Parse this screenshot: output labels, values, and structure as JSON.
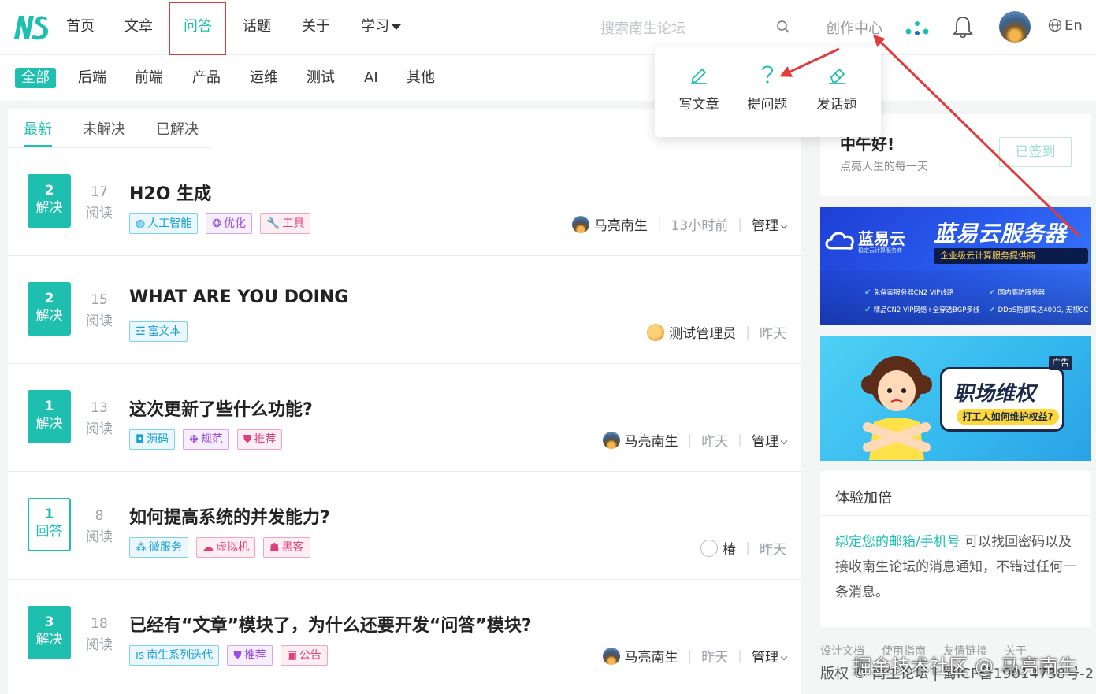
{
  "header": {
    "nav": [
      "首页",
      "文章",
      "问答",
      "话题",
      "关于",
      "学习"
    ],
    "active_nav": "问答",
    "search_placeholder": "搜索南生论坛",
    "creator": "创作中心",
    "lang": "En"
  },
  "creator_menu": [
    "写文章",
    "提问题",
    "发话题"
  ],
  "categories": [
    "全部",
    "后端",
    "前端",
    "产品",
    "运维",
    "测试",
    "AI",
    "其他"
  ],
  "tabs": [
    "最新",
    "未解决",
    "已解决"
  ],
  "questions": [
    {
      "count": "2",
      "status": "解决",
      "views": "17",
      "views_label": "阅读",
      "title": "H2O 生成",
      "tags": [
        {
          "label": "人工智能",
          "style": "cyan",
          "icon": "◍"
        },
        {
          "label": "优化",
          "style": "purple",
          "icon": "❂"
        },
        {
          "label": "工具",
          "style": "pink",
          "icon": "🔧"
        }
      ],
      "author": "马亮南生",
      "time": "13小时前",
      "manage": "管理"
    },
    {
      "count": "2",
      "status": "解决",
      "views": "15",
      "views_label": "阅读",
      "title": "WHAT ARE YOU DOING",
      "tags": [
        {
          "label": "富文本",
          "style": "cyan",
          "icon": "☲"
        }
      ],
      "author": "测试管理员",
      "time": "昨天",
      "manage": ""
    },
    {
      "count": "1",
      "status": "解决",
      "views": "13",
      "views_label": "阅读",
      "title": "这次更新了些什么功能?",
      "tags": [
        {
          "label": "源码",
          "style": "cyan",
          "icon": "◘"
        },
        {
          "label": "规范",
          "style": "purple",
          "icon": "❉"
        },
        {
          "label": "推荐",
          "style": "pink",
          "icon": "⛊"
        }
      ],
      "author": "马亮南生",
      "time": "昨天",
      "manage": "管理"
    },
    {
      "count": "1",
      "status": "回答",
      "views": "8",
      "views_label": "阅读",
      "title": "如何提高系统的并发能力?",
      "tags": [
        {
          "label": "微服务",
          "style": "cyan",
          "icon": "⁂"
        },
        {
          "label": "虚拟机",
          "style": "pink",
          "icon": "☁"
        },
        {
          "label": "黑客",
          "style": "pink",
          "icon": "☗"
        }
      ],
      "author": "椿",
      "time": "昨天",
      "manage": ""
    },
    {
      "count": "3",
      "status": "解决",
      "views": "18",
      "views_label": "阅读",
      "title": "已经有“文章”模块了，为什么还要开发“问答”模块?",
      "tags": [
        {
          "label": "南生系列迭代",
          "style": "cyan",
          "icon": "ıs"
        },
        {
          "label": "推荐",
          "style": "purple",
          "icon": "⛊"
        },
        {
          "label": "公告",
          "style": "pink",
          "icon": "▣"
        }
      ],
      "author": "马亮南生",
      "time": "昨天",
      "manage": "管理"
    }
  ],
  "sidebar": {
    "greeting": "中午好!",
    "greeting_sub": "点亮人生的每一天",
    "signed_label": "已签到",
    "ad1": {
      "brand": "蓝易云",
      "brand_sub": "稳定云计算服务商",
      "headline": "蓝易云服务器",
      "slogan": "企业级云计算服务提供商",
      "features": [
        "免备案服务器CN2 VIP线路",
        "国内高防服务器",
        "精品CN2 VIP网络+全穿透BGP多线",
        "DDoS防御高达400G, 无视CC"
      ]
    },
    "ad2": {
      "title": "职场维权",
      "subtitle": "打工人如何维护权益?",
      "badge": "广告"
    },
    "experience": {
      "title": "体验加倍",
      "link": "绑定您的邮箱/手机号",
      "text": " 可以找回密码以及接收南生论坛的消息通知，不错过任何一条消息。"
    },
    "footer_links": [
      "设计文档",
      "使用指南",
      "友情链接",
      "关于"
    ],
    "copyright": "版权 © 南生论坛 | 蜀ICP备19014738号-2"
  },
  "watermark": "掘金技术社区 @ 马亮南生",
  "colors": {
    "accent": "#1fbfb0",
    "highlight": "#e23b3b"
  }
}
